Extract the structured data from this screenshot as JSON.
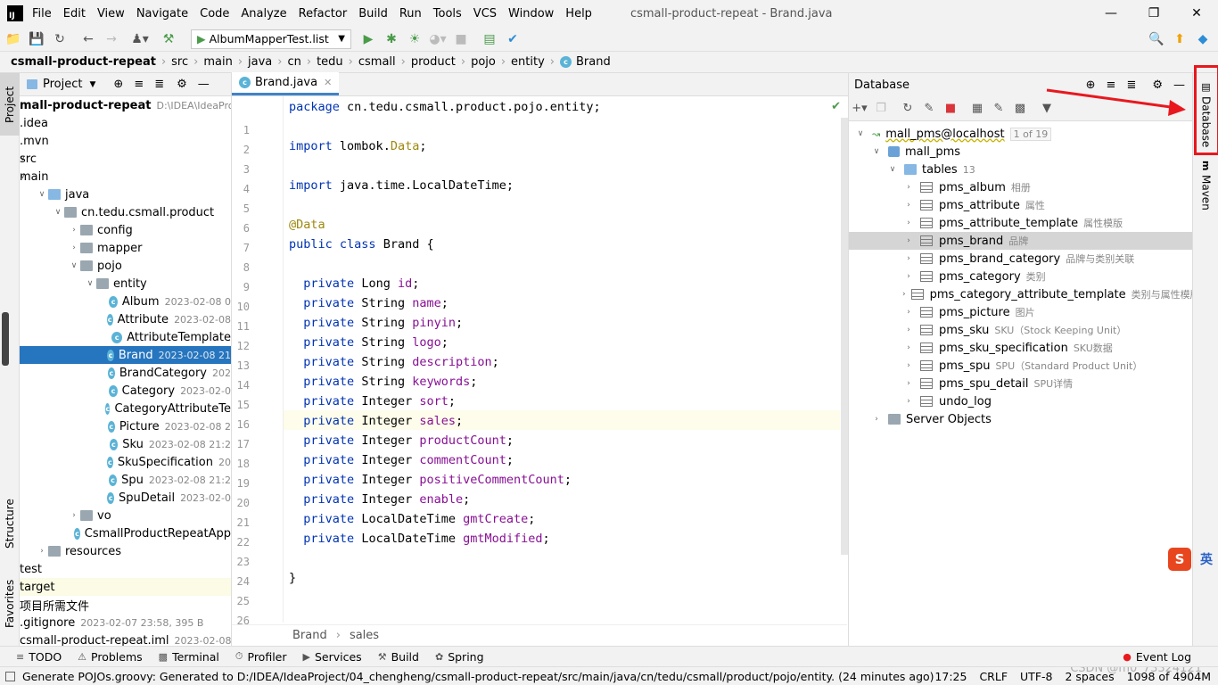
{
  "window": {
    "title": "csmall-product-repeat - Brand.java"
  },
  "menu": [
    "File",
    "Edit",
    "View",
    "Navigate",
    "Code",
    "Analyze",
    "Refactor",
    "Build",
    "Run",
    "Tools",
    "VCS",
    "Window",
    "Help"
  ],
  "toolbar": {
    "run_config": "AlbumMapperTest.list"
  },
  "breadcrumb": [
    "csmall-product-repeat",
    "src",
    "main",
    "java",
    "cn",
    "tedu",
    "csmall",
    "product",
    "pojo",
    "entity",
    "Brand"
  ],
  "left_stripe": {
    "project": "Project",
    "structure": "Structure",
    "favorites": "Favorites"
  },
  "project_panel": {
    "title": "Project",
    "tree": [
      {
        "label": "mall-product-repeat",
        "meta": "D:\\IDEA\\IdeaProject",
        "depth": 0
      },
      {
        "label": ".idea",
        "meta": "",
        "depth": 0
      },
      {
        "label": ".mvn",
        "meta": "",
        "depth": 0
      },
      {
        "label": "src",
        "meta": "",
        "depth": 0
      },
      {
        "label": "main",
        "meta": "",
        "depth": 0
      },
      {
        "label": "java",
        "meta": "",
        "depth": 1
      },
      {
        "label": "cn.tedu.csmall.product",
        "meta": "",
        "depth": 2
      },
      {
        "label": "config",
        "meta": "",
        "depth": 3
      },
      {
        "label": "mapper",
        "meta": "",
        "depth": 3
      },
      {
        "label": "pojo",
        "meta": "",
        "depth": 3
      },
      {
        "label": "entity",
        "meta": "",
        "depth": 4
      },
      {
        "label": "Album",
        "meta": "2023-02-08 0",
        "depth": 5
      },
      {
        "label": "Attribute",
        "meta": "2023-02-08",
        "depth": 5
      },
      {
        "label": "AttributeTemplate",
        "meta": "",
        "depth": 5
      },
      {
        "label": "Brand",
        "meta": "2023-02-08 21",
        "depth": 5
      },
      {
        "label": "BrandCategory",
        "meta": "202",
        "depth": 5
      },
      {
        "label": "Category",
        "meta": "2023-02-0",
        "depth": 5
      },
      {
        "label": "CategoryAttributeTe",
        "meta": "",
        "depth": 5
      },
      {
        "label": "Picture",
        "meta": "2023-02-08 2",
        "depth": 5
      },
      {
        "label": "Sku",
        "meta": "2023-02-08 21:2",
        "depth": 5
      },
      {
        "label": "SkuSpecification",
        "meta": "20",
        "depth": 5
      },
      {
        "label": "Spu",
        "meta": "2023-02-08 21:2",
        "depth": 5
      },
      {
        "label": "SpuDetail",
        "meta": "2023-02-0",
        "depth": 5
      },
      {
        "label": "vo",
        "meta": "",
        "depth": 3
      },
      {
        "label": "CsmallProductRepeatApp",
        "meta": "",
        "depth": 3
      },
      {
        "label": "resources",
        "meta": "",
        "depth": 1
      },
      {
        "label": "test",
        "meta": "",
        "depth": 0
      },
      {
        "label": "target",
        "meta": "",
        "depth": 0
      },
      {
        "label": "项目所需文件",
        "meta": "",
        "depth": 0
      },
      {
        "label": ".gitignore",
        "meta": "2023-02-07 23:58, 395 B",
        "depth": 0
      },
      {
        "label": "csmall-product-repeat.iml",
        "meta": "2023-02-08 09:2",
        "depth": 0
      }
    ]
  },
  "editor": {
    "tab": "Brand.java",
    "line_numbers": [
      "1",
      "2",
      "3",
      "4",
      "5",
      "6",
      "7",
      "8",
      "9",
      "10",
      "11",
      "12",
      "13",
      "14",
      "15",
      "16",
      "17",
      "18",
      "19",
      "20",
      "21",
      "22",
      "23",
      "24",
      "25",
      "26"
    ],
    "lines": [
      "package cn.tedu.csmall.product.pojo.entity;",
      "",
      "import lombok.Data;",
      "",
      "import java.time.LocalDateTime;",
      "",
      "@Data",
      "public class Brand {",
      "",
      "  private Long id;",
      "  private String name;",
      "  private String pinyin;",
      "  private String logo;",
      "  private String description;",
      "  private String keywords;",
      "  private Integer sort;",
      "  private Integer sales;",
      "  private Integer productCount;",
      "  private Integer commentCount;",
      "  private Integer positiveCommentCount;",
      "  private Integer enable;",
      "  private LocalDateTime gmtCreate;",
      "  private LocalDateTime gmtModified;",
      "",
      "}",
      ""
    ],
    "breadcrumb": [
      "Brand",
      "sales"
    ]
  },
  "database": {
    "title": "Database",
    "connection": "mall_pms@localhost",
    "connection_badge": "1 of 19",
    "schema": "mall_pms",
    "tables_label": "tables",
    "tables_count": "13",
    "tables": [
      {
        "name": "pms_album",
        "comment": "相册"
      },
      {
        "name": "pms_attribute",
        "comment": "属性"
      },
      {
        "name": "pms_attribute_template",
        "comment": "属性模版"
      },
      {
        "name": "pms_brand",
        "comment": "品牌"
      },
      {
        "name": "pms_brand_category",
        "comment": "品牌与类别关联"
      },
      {
        "name": "pms_category",
        "comment": "类别"
      },
      {
        "name": "pms_category_attribute_template",
        "comment": "类别与属性模版关"
      },
      {
        "name": "pms_picture",
        "comment": "图片"
      },
      {
        "name": "pms_sku",
        "comment": "SKU（Stock Keeping Unit）"
      },
      {
        "name": "pms_sku_specification",
        "comment": "SKU数据"
      },
      {
        "name": "pms_spu",
        "comment": "SPU（Standard Product Unit）"
      },
      {
        "name": "pms_spu_detail",
        "comment": "SPU详情"
      },
      {
        "name": "undo_log",
        "comment": ""
      }
    ],
    "server_objects": "Server Objects"
  },
  "right_stripe": {
    "database": "Database",
    "maven": "Maven",
    "ime": "英"
  },
  "tool_windows": [
    "TODO",
    "Problems",
    "Terminal",
    "Profiler",
    "Services",
    "Build",
    "Spring"
  ],
  "event_log": "Event Log",
  "status": {
    "message": "Generate POJOs.groovy: Generated to D:/IDEA/IdeaProject/04_chengheng/csmall-product-repeat/src/main/java/cn/tedu/csmall/product/pojo/entity. (24 minutes ago)",
    "position": "17:25",
    "line_sep": "CRLF",
    "encoding": "UTF-8",
    "indent": "2 spaces",
    "memory": "1098 of 4904M",
    "watermark": "CSDN @m0_73324121"
  },
  "colors": {
    "accent": "#2675bf",
    "highlight_box": "#e8181e",
    "arrow": "#e8181e"
  }
}
